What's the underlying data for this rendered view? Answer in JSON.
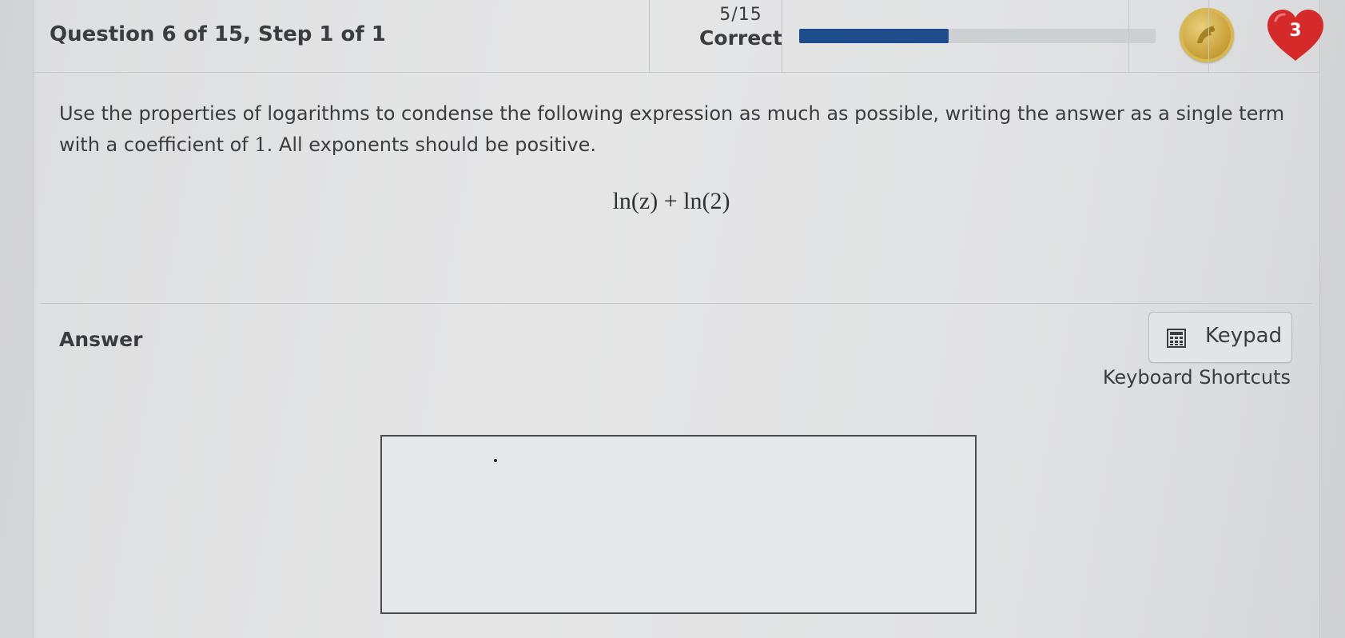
{
  "header": {
    "question_title": "Question 6 of 15, Step 1 of 1",
    "score_fraction": "5/15",
    "score_label": "Correct",
    "progress_fraction": 0.42,
    "hearts_count": "3",
    "coin_icon": "gold-coin-icon",
    "heart_icon": "heart-icon"
  },
  "question": {
    "prompt_part1": "Use the properties of logarithms to condense the following expression as much as possible, writing the answer as a single term with a coefficient of ",
    "prompt_number": "1",
    "prompt_part2": ". All exponents should be positive.",
    "expression": "ln(z) + ln(2)"
  },
  "answer": {
    "label": "Answer",
    "keypad_label": "Keypad",
    "keypad_icon": "calculator-icon",
    "shortcuts_label": "Keyboard Shortcuts",
    "input_value": ""
  },
  "colors": {
    "progress_fill": "#1d4d8c",
    "progress_track": "#cdd0d3",
    "heart": "#d62a2a",
    "coin": "#c9a13a"
  }
}
